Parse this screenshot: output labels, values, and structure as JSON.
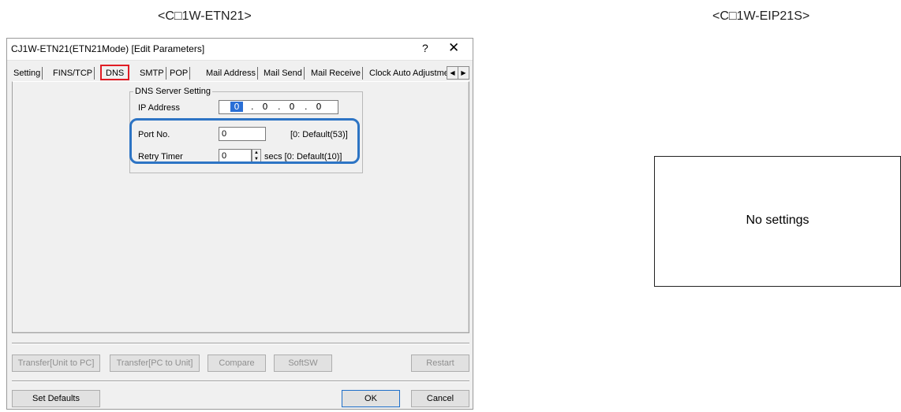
{
  "captions": {
    "left": "<C□1W-ETN21>",
    "right": "<C□1W-EIP21S>"
  },
  "dialog": {
    "title": "CJ1W-ETN21(ETN21Mode) [Edit Parameters]",
    "help": "?",
    "close": "✕",
    "tabs": [
      "Setting",
      "FINS/TCP",
      "DNS",
      "SMTP",
      "POP",
      "Mail Address",
      "Mail Send",
      "Mail Receive",
      "Clock Auto Adjustme"
    ],
    "active_tab": "DNS",
    "dns_group": {
      "title": "DNS Server Setting",
      "ip_label": "IP Address",
      "ip_octets": [
        "0",
        "0",
        "0",
        "0"
      ],
      "port_label": "Port No.",
      "port_value": "0",
      "port_hint": "[0: Default(53)]",
      "retry_label": "Retry Timer",
      "retry_value": "0",
      "retry_hint": "secs [0: Default(10)]"
    },
    "buttons": {
      "transfer_unit_to_pc": "Transfer[Unit to PC]",
      "transfer_pc_to_unit": "Transfer[PC to Unit]",
      "compare": "Compare",
      "softsw": "SoftSW",
      "restart": "Restart",
      "set_defaults": "Set Defaults",
      "ok": "OK",
      "cancel": "Cancel"
    }
  },
  "right_panel": {
    "text": "No settings"
  },
  "colors": {
    "tab_highlight": "#e01c24",
    "group_highlight": "#2d74c4"
  }
}
